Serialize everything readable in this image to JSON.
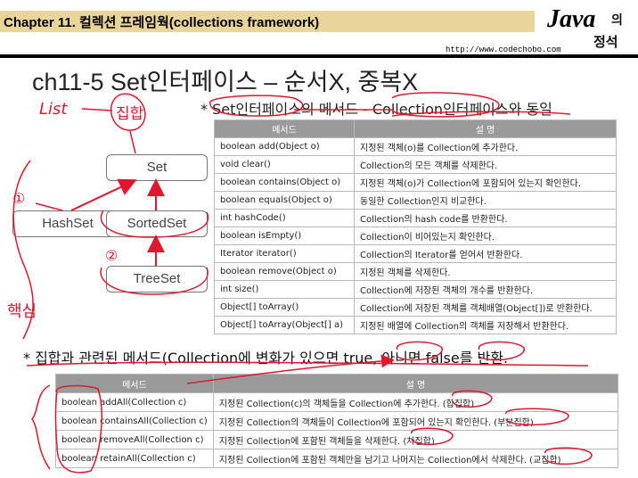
{
  "header": {
    "title": "Chapter 11. 컬렉션 프레임웍(collections framework)",
    "brand_java": "Java",
    "brand_ui": "의",
    "brand_jeongseok": "정석",
    "url": "http://www.codechobo.com"
  },
  "slide": {
    "title": "ch11-5 Set인터페이스 – 순서X, 중복X",
    "subtitle": "* Set인터페이스의 메서드 - Collection인터페이스와 동일"
  },
  "diagram": {
    "set": "Set",
    "hashset": "HashSet",
    "sortedset": "SortedSet",
    "treeset": "TreeSet"
  },
  "table1": {
    "headers": [
      "메서드",
      "설 명"
    ],
    "rows": [
      [
        "boolean add(Object o)",
        "지정된 객체(o)를 Collection에 추가한다."
      ],
      [
        "void clear()",
        "Collection의 모든 객체를 삭제한다."
      ],
      [
        "boolean contains(Object o)",
        "지정된 객체(o)가 Collection에 포함되어 있는지 확인한다."
      ],
      [
        "boolean equals(Object o)",
        "동일한 Collection인지 비교한다."
      ],
      [
        "int hashCode()",
        "Collection의 hash code를 반환한다."
      ],
      [
        "boolean isEmpty()",
        "Collection이 비어있는지 확인한다."
      ],
      [
        "Iterator iterator()",
        "Collection의 Iterator를 얻어서 반환한다."
      ],
      [
        "boolean remove(Object o)",
        "지정된 객체를 삭제한다."
      ],
      [
        "int size()",
        "Collection에 저장된 객체의 개수를 반환한다."
      ],
      [
        "Object[] toArray()",
        "Collection에 저장된 객체를 객체배열(Object[])로 반환한다."
      ],
      [
        "Object[] toArray(Object[] a)",
        "지정된 배열에 Collection의 객체를 저장해서 반환한다."
      ]
    ]
  },
  "section2": {
    "text": "* 집합과 관련된 메서드(Collection에 변화가 있으면 true, 아니면 false를 반환."
  },
  "table2": {
    "headers": [
      "메서드",
      "설 명"
    ],
    "rows": [
      [
        "boolean addAll(Collection c)",
        "지정된 Collection(c)의 객체들을 Collection에 추가한다. (합집합)"
      ],
      [
        "boolean containsAll(Collection c)",
        "지정된 Collection의 객체들이 Collection에 포함되어 있는지 확인한다. (부분집합)"
      ],
      [
        "boolean removeAll(Collection c)",
        "지정된 Collection에 포함된 객체들을 삭제한다. (차집합)"
      ],
      [
        "boolean retainAll(Collection c)",
        "지정된 Collection에 포함된 객체만을 남기고 나머지는 Collection에서 삭제한다. (교집합)"
      ]
    ]
  },
  "handwriting": {
    "list": "List",
    "jiphap": "집합",
    "haeksim": "핵심",
    "num1": "①",
    "num2": "②"
  },
  "colors": {
    "header_band": "#e9d59a",
    "annotation": "#e0182d",
    "table_header": "#9a9a9a",
    "arrow": "#e0182d"
  }
}
